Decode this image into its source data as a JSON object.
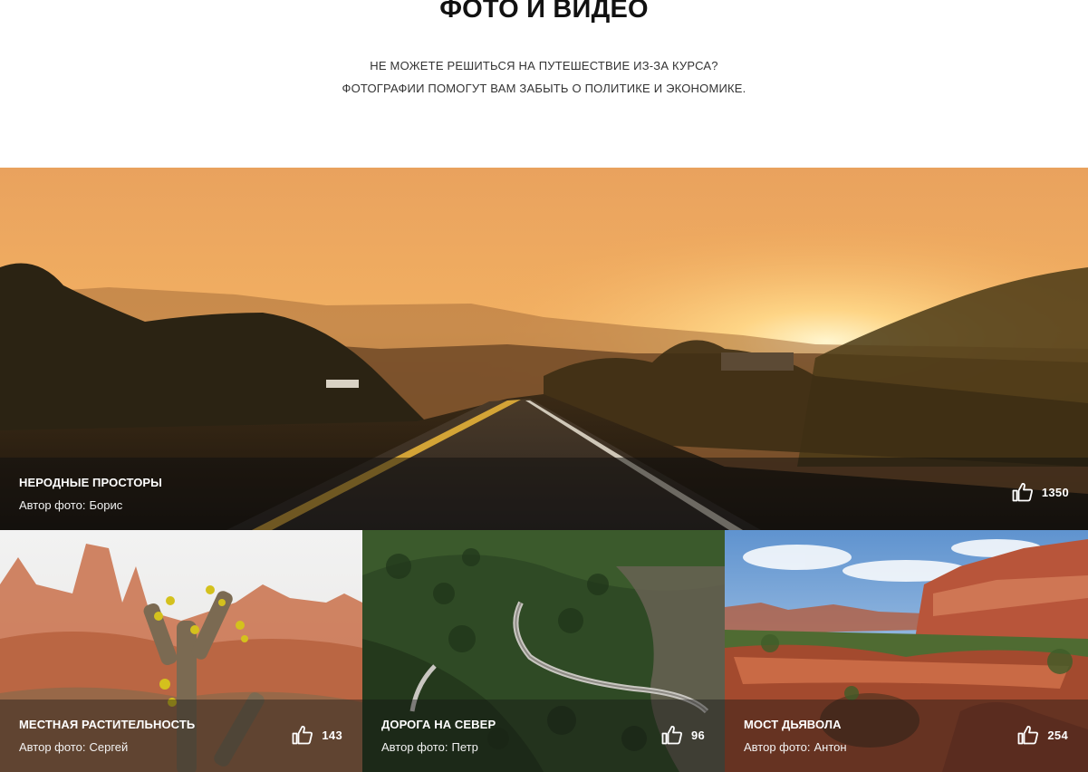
{
  "section": {
    "title": "ФОТО И ВИДЕО",
    "subtitle_line1": "НЕ МОЖЕТЕ РЕШИТЬСЯ НА ПУТЕШЕСТВИЕ ИЗ-ЗА КУРСА?",
    "subtitle_line2": "ФОТОГРАФИИ ПОМОГУТ ВАМ ЗАБЫТЬ О ПОЛИТИКЕ И ЭКОНОМИКЕ."
  },
  "photos": [
    {
      "title": "НЕРОДНЫЕ ПРОСТОРЫ",
      "author_label": "Автор фото:",
      "author": "Борис",
      "likes": "1350",
      "icon": "thumbs-up-icon"
    },
    {
      "title": "МЕСТНАЯ РАСТИТЕЛЬНОСТЬ",
      "author_label": "Автор фото:",
      "author": "Сергей",
      "likes": "143",
      "icon": "thumbs-up-icon"
    },
    {
      "title": "ДОРОГА НА СЕВЕР",
      "author_label": "Автор фото:",
      "author": "Петр",
      "likes": "96",
      "icon": "thumbs-up-icon"
    },
    {
      "title": "МОСТ ДЬЯВОЛА",
      "author_label": "Автор фото:",
      "author": "Антон",
      "likes": "254",
      "icon": "thumbs-up-icon"
    }
  ],
  "colors": {
    "caption_overlay": "#141414",
    "caption_text": "#ffffff",
    "heading_text": "#111111"
  }
}
